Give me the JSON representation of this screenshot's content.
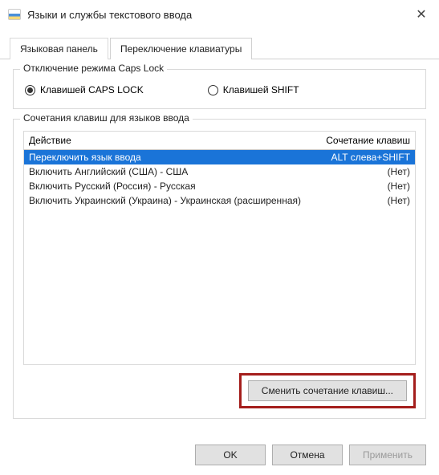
{
  "window": {
    "title": "Языки и службы текстового ввода"
  },
  "tabs": {
    "lang_panel": "Языковая панель",
    "kb_switch": "Переключение клавиатуры"
  },
  "capslock_group": {
    "title": "Отключение режима Caps Lock",
    "opt_caps": "Клавишей CAPS LOCK",
    "opt_shift": "Клавишей SHIFT"
  },
  "hotkeys_group": {
    "title": "Сочетания клавиш для языков ввода",
    "col_action": "Действие",
    "col_combo": "Сочетание клавиш",
    "rows": [
      {
        "action": "Переключить язык ввода",
        "combo": "ALT слева+SHIFT"
      },
      {
        "action": "Включить Английский (США) - США",
        "combo": "(Нет)"
      },
      {
        "action": "Включить Русский (Россия) - Русская",
        "combo": "(Нет)"
      },
      {
        "action": "Включить Украинский (Украина) - Украинская (расширенная)",
        "combo": "(Нет)"
      }
    ],
    "change_btn": "Сменить сочетание клавиш..."
  },
  "buttons": {
    "ok": "OK",
    "cancel": "Отмена",
    "apply": "Применить"
  }
}
